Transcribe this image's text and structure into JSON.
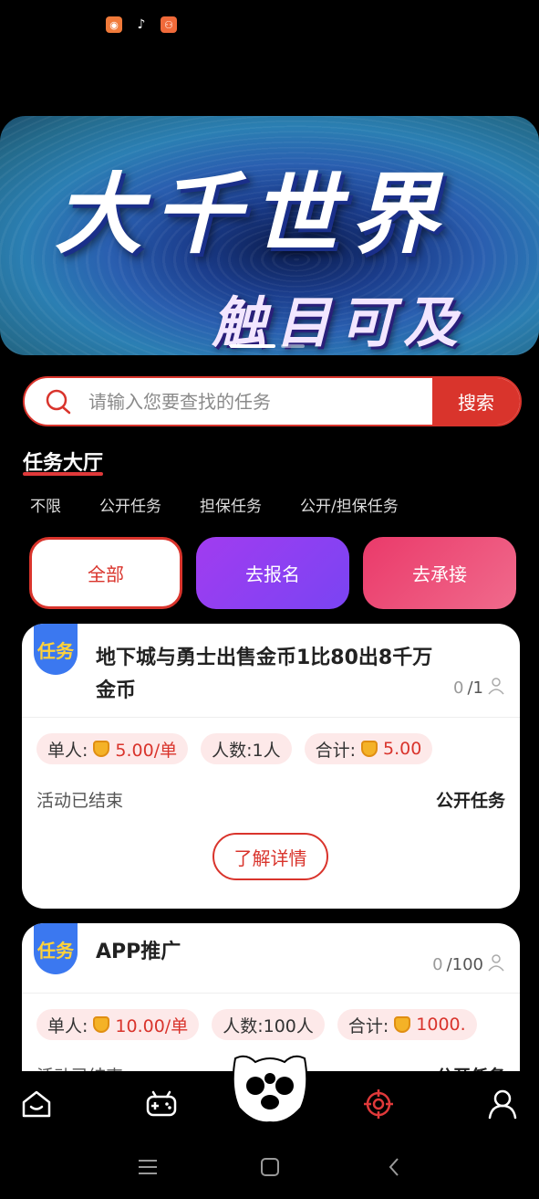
{
  "status_bar": {
    "icons": [
      "app-orange-icon",
      "tiktok-icon",
      "kuaishou-icon"
    ]
  },
  "banner": {
    "title": "大千世界",
    "subtitle": "触目可及",
    "slides": 2,
    "active_slide": 1
  },
  "search": {
    "placeholder": "请输入您要查找的任务",
    "button_label": "搜索"
  },
  "section": {
    "title": "任务大厅"
  },
  "filters": [
    "不限",
    "公开任务",
    "担保任务",
    "公开/担保任务"
  ],
  "actions": {
    "all": "全部",
    "signup": "去报名",
    "accept": "去承接"
  },
  "tasks": [
    {
      "badge": "任务",
      "title": "地下城与勇士出售金币1比80出8千万金币",
      "count_done": "0",
      "count_total": "/1",
      "unit_label": "单人:",
      "unit_value": "5.00/单",
      "people_label": "人数:1人",
      "total_label": "合计:",
      "total_value": "5.00",
      "status": "活动已结束",
      "type": "公开任务",
      "detail_button": "了解详情"
    },
    {
      "badge": "任务",
      "title": "APP推广",
      "count_done": "0",
      "count_total": "/100",
      "unit_label": "单人:",
      "unit_value": "10.00/单",
      "people_label": "人数:100人",
      "total_label": "合计:",
      "total_value": "1000.",
      "status": "活动已结束",
      "type": "公开任务"
    }
  ],
  "bottom_nav": [
    "home-icon",
    "gamepad-icon",
    "mascot-icon",
    "target-icon",
    "user-icon"
  ],
  "colors": {
    "accent": "#d9342c",
    "purple": "#8a40f2",
    "pink": "#ea3a6a",
    "badge_blue": "#3b78f0"
  }
}
